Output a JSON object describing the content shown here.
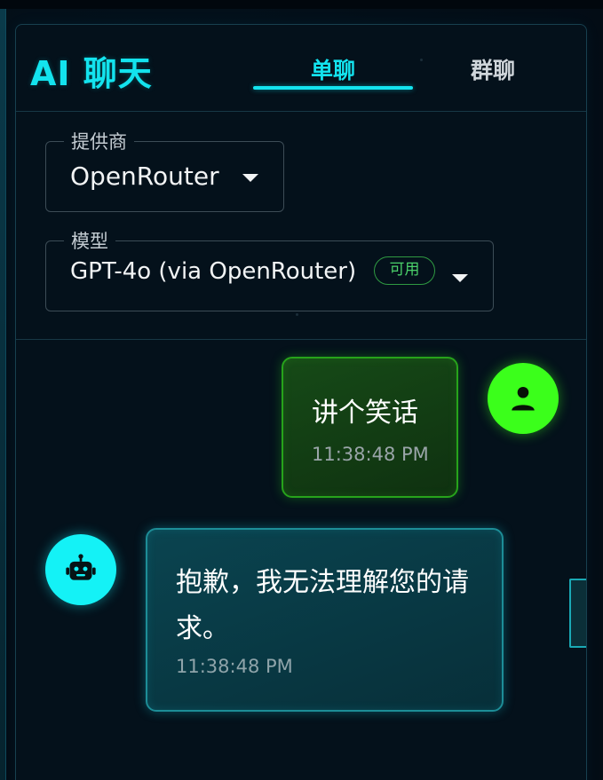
{
  "app": {
    "title": "AI 聊天"
  },
  "tabs": [
    {
      "label": "单聊",
      "active": true
    },
    {
      "label": "群聊",
      "active": false
    }
  ],
  "provider": {
    "label": "提供商",
    "value": "OpenRouter"
  },
  "model": {
    "label": "模型",
    "value": "GPT-4o (via OpenRouter)",
    "status": "可用"
  },
  "messages": [
    {
      "role": "user",
      "text": "讲个笑话",
      "time": "11:38:48 PM",
      "avatar_icon": "person-icon"
    },
    {
      "role": "assistant",
      "text": "抱歉，我无法理解您的请求。",
      "time": "11:38:48 PM",
      "avatar_icon": "robot-icon"
    }
  ],
  "colors": {
    "accent": "#13e3ee",
    "user_avatar": "#3bff1b",
    "bot_avatar": "#14f2f6",
    "status_green": "#4bd16a",
    "background": "#030c15"
  }
}
